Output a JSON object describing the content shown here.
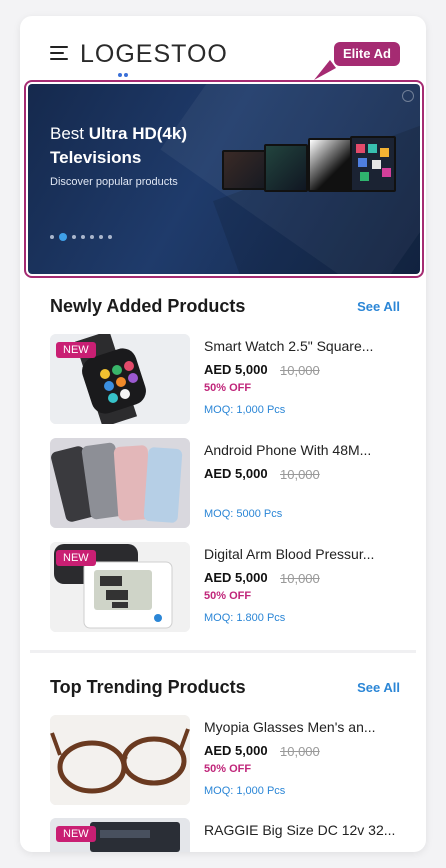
{
  "header": {
    "logo_text": "LOGESTOO",
    "elite_tag": "Elite Ad"
  },
  "banner": {
    "title_prefix": "Best ",
    "title_bold_1": "Ultra HD(4k)",
    "title_bold_2": "Televisions",
    "subtitle": "Discover popular products",
    "active_slide": 2,
    "slide_count": 7
  },
  "sections": [
    {
      "title": "Newly Added Products",
      "see_all": "See All",
      "products": [
        {
          "name": "Smart Watch 2.5\" Square...",
          "price": "AED 5,000",
          "old_price": "10,000",
          "discount": "50% OFF",
          "moq": "MOQ: 1,000 Pcs",
          "badge": "NEW",
          "image": "smartwatch"
        },
        {
          "name": "Android Phone With 48M...",
          "price": "AED 5,000",
          "old_price": "10,000",
          "discount": "",
          "moq": "MOQ: 5000 Pcs",
          "badge": "",
          "image": "phones"
        },
        {
          "name": "Digital Arm Blood Pressur...",
          "price": "AED 5,000",
          "old_price": "10,000",
          "discount": "50% OFF",
          "moq": "MOQ: 1.800 Pcs",
          "badge": "NEW",
          "image": "blood-pressure-monitor"
        }
      ]
    },
    {
      "title": "Top Trending Products",
      "see_all": "See All",
      "products": [
        {
          "name": "Myopia Glasses Men's an...",
          "price": "AED 5,000",
          "old_price": "10,000",
          "discount": "50% OFF",
          "moq": "MOQ: 1,000 Pcs",
          "badge": "",
          "image": "glasses"
        },
        {
          "name": "RAGGIE Big Size DC 12v 32...",
          "badge": "NEW",
          "image": "device"
        }
      ]
    }
  ],
  "colors": {
    "accent": "#a52b72",
    "badge": "#c91f73",
    "link": "#2b86d6",
    "banner_bg": "#1f3b6b"
  }
}
